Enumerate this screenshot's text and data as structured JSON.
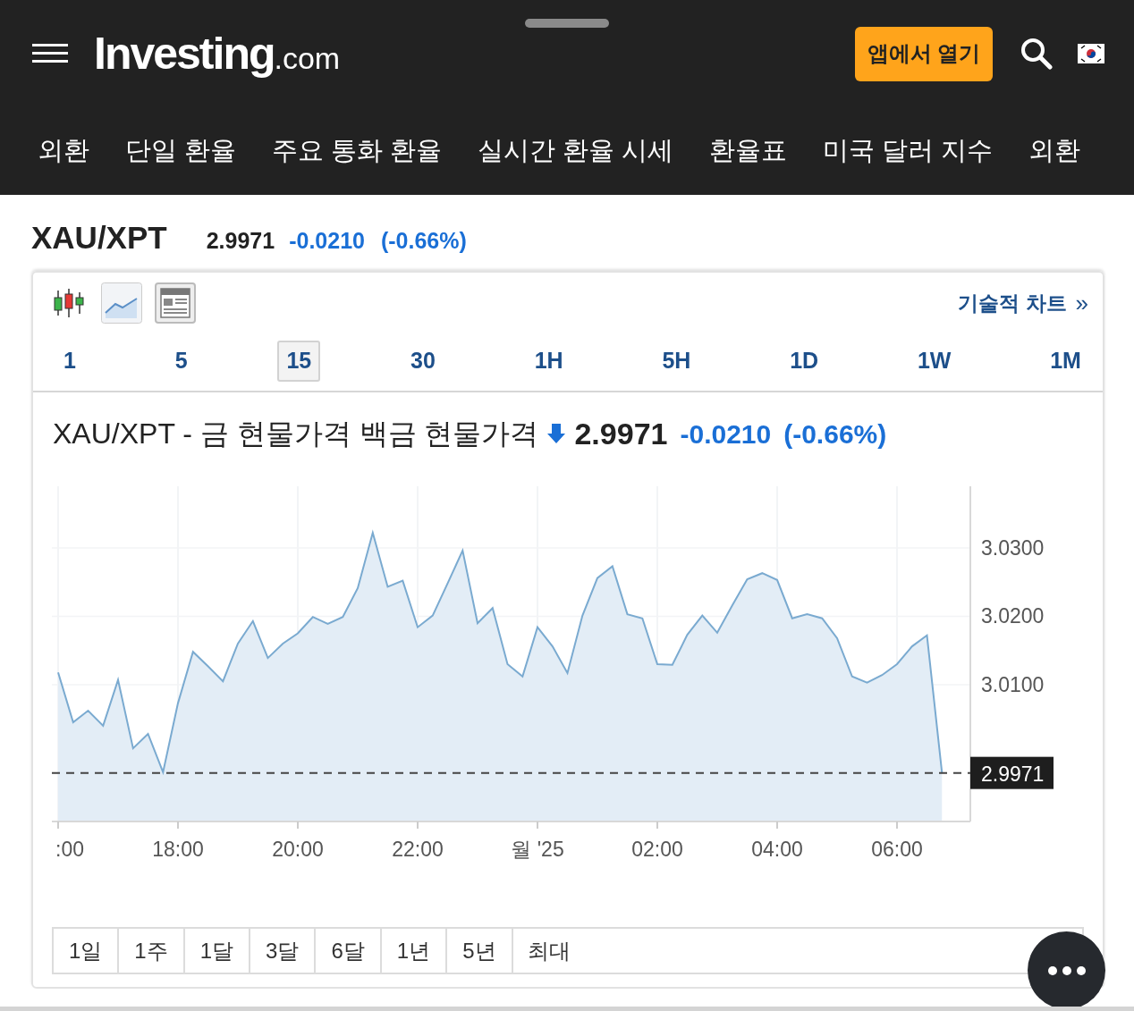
{
  "header": {
    "logo": "Investing",
    "logo_suffix": ".com",
    "app_button": "앱에서 열기"
  },
  "nav": [
    "외환",
    "단일 환율",
    "주요 통화 환율",
    "실시간 환율 시세",
    "환율표",
    "미국 달러 지수",
    "외환"
  ],
  "quote": {
    "symbol": "XAU/XPT",
    "price": "2.9971",
    "change": "-0.0210",
    "change_pct": "(-0.66%)"
  },
  "chart_panel": {
    "tech_link": "기술적 차트",
    "tech_link_arrow": "»",
    "intervals": [
      {
        "label": "1",
        "selected": false
      },
      {
        "label": "5",
        "selected": false
      },
      {
        "label": "15",
        "selected": true
      },
      {
        "label": "30",
        "selected": false
      },
      {
        "label": "1H",
        "selected": false
      },
      {
        "label": "5H",
        "selected": false
      },
      {
        "label": "1D",
        "selected": false
      },
      {
        "label": "1W",
        "selected": false
      },
      {
        "label": "1M",
        "selected": false
      }
    ],
    "title": "XAU/XPT - 금 현물가격 백금 현물가격",
    "price": "2.9971",
    "change": "-0.0210",
    "change_pct": "(-0.66%)",
    "chart_data": {
      "type": "area",
      "categories": [
        ":00",
        null,
        null,
        null,
        null,
        null,
        null,
        null,
        "18:00",
        null,
        null,
        null,
        null,
        null,
        null,
        null,
        "20:00",
        null,
        null,
        null,
        null,
        null,
        null,
        null,
        "22:00",
        null,
        null,
        null,
        null,
        null,
        null,
        null,
        "월 '25",
        null,
        null,
        null,
        null,
        null,
        null,
        null,
        "02:00",
        null,
        null,
        null,
        null,
        null,
        null,
        null,
        "04:00",
        null,
        null,
        null,
        null,
        null,
        null,
        null,
        "06:00",
        null,
        null,
        null
      ],
      "series": [
        {
          "color": "#7aaad0",
          "values": [
            3.0118,
            3.0045,
            3.0062,
            3.004,
            3.0107,
            3.0007,
            3.0028,
            2.9972,
            3.0073,
            3.0148,
            3.0127,
            3.0105,
            3.016,
            3.0193,
            3.0139,
            3.016,
            3.0175,
            3.0199,
            3.0189,
            3.0199,
            3.0241,
            3.0322,
            3.0243,
            3.0252,
            3.0184,
            3.0201,
            3.0248,
            3.0296,
            3.019,
            3.0212,
            3.013,
            3.0112,
            3.0184,
            3.0156,
            3.0117,
            3.0201,
            3.0256,
            3.0273,
            3.0203,
            3.0197,
            3.013,
            3.0129,
            3.0173,
            3.0201,
            3.0176,
            3.0216,
            3.0254,
            3.0263,
            3.0253,
            3.0197,
            3.0203,
            3.0197,
            3.0168,
            3.0112,
            3.0103,
            3.0114,
            3.013,
            3.0156,
            3.0172,
            2.9971
          ]
        }
      ],
      "ylim": [
        2.99,
        3.039
      ],
      "grid": true,
      "yticks": [
        {
          "value": 3.01,
          "label": "3.0100"
        },
        {
          "value": 3.02,
          "label": "3.0200"
        },
        {
          "value": 3.03,
          "label": "3.0300"
        }
      ]
    },
    "last_price_tag": "2.9971",
    "ranges": [
      "1일",
      "1주",
      "1달",
      "3달",
      "6달",
      "1년",
      "5년",
      "최대"
    ]
  }
}
